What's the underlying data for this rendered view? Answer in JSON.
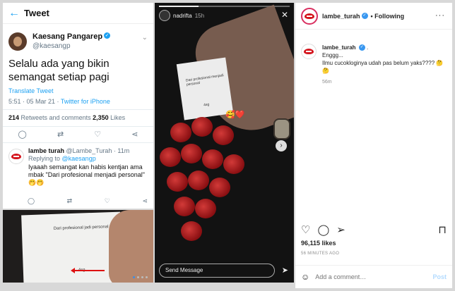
{
  "tweet": {
    "header_title": "Tweet",
    "author_name": "Kaesang Pangarep",
    "author_handle": "@kaesangp",
    "text": "Selalu ada yang bikin semangat setiap pagi",
    "translate_label": "Translate Tweet",
    "time": "5:51 · 05 Mar 21 · ",
    "client": "Twitter for iPhone",
    "retweets_count": "214",
    "retweets_label": " Retweets and comments  ",
    "likes_count": "2,350",
    "likes_label": " Likes",
    "reply": {
      "name": "lambe turah",
      "handle_time": " @Lambe_Turah · 11m",
      "replying_to_label": "Replying to ",
      "replying_to_handle": "@kaesangp",
      "text": "Iyaaah semangat kan habis kentjan ama mbak \"Dari profesional menjadi personal\" 🤭🤭"
    }
  },
  "bottom_photo": {
    "paper_text": "Dari profesional jadi personal",
    "paper_small": "4sg"
  },
  "story": {
    "username": "nadrifta",
    "time": "15h",
    "card_text": "Dari profesional menjadi personal",
    "card_small": "4sg",
    "sticker": "🥰❤️",
    "send_placeholder": "Send Message"
  },
  "instagram": {
    "username": "lambe_turah",
    "following_label": "• Following",
    "caption_user": "lambe_turah",
    "caption_lines": [
      "Enggg...",
      "Ilmu cucokloginya udah pas belum yaks???? 🤔🤔"
    ],
    "caption_time": "56m",
    "likes": "96,115 likes",
    "time_ago": "56 MINUTES AGO",
    "comment_placeholder": "Add a comment…",
    "post_label": "Post"
  },
  "colors": {
    "twitter_blue": "#1da1f2",
    "instagram_link": "#3897f0",
    "brand_red": "#d4151d"
  }
}
